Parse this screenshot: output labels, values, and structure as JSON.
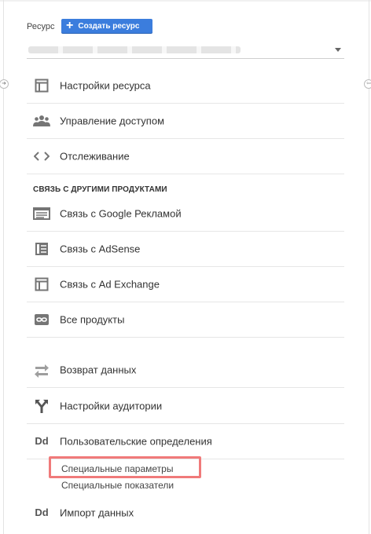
{
  "header": {
    "resource_label": "Ресурс",
    "create_button": "Создать ресурс"
  },
  "menu": {
    "items_top": [
      {
        "label": "Настройки ресурса",
        "icon": "window-icon"
      },
      {
        "label": "Управление доступом",
        "icon": "users-icon"
      },
      {
        "label": "Отслеживание",
        "icon": "code-icon"
      }
    ],
    "section_title": "СВЯЗЬ С ДРУГИМИ ПРОДУКТАМИ",
    "items_links": [
      {
        "label": "Связь с Google Рекламой",
        "icon": "ads-icon"
      },
      {
        "label": "Связь с AdSense",
        "icon": "adsense-icon"
      },
      {
        "label": "Связь с Ad Exchange",
        "icon": "window-icon"
      },
      {
        "label": "Все продукты",
        "icon": "link-icon"
      }
    ],
    "items_bottom": [
      {
        "label": "Возврат данных",
        "icon": "swap-icon"
      },
      {
        "label": "Настройки аудитории",
        "icon": "fork-icon"
      },
      {
        "label": "Пользовательские определения",
        "icon": "dd-icon",
        "icon_text": "Dd"
      }
    ],
    "sub_items": [
      {
        "label": "Специальные параметры",
        "highlighted": true
      },
      {
        "label": "Специальные показатели"
      }
    ],
    "import": {
      "label": "Импорт данных",
      "icon": "dd-icon",
      "icon_text": "Dd"
    }
  },
  "colors": {
    "accent": "#3b7ddd",
    "highlight": "#f07a7a",
    "icon": "#757575"
  }
}
